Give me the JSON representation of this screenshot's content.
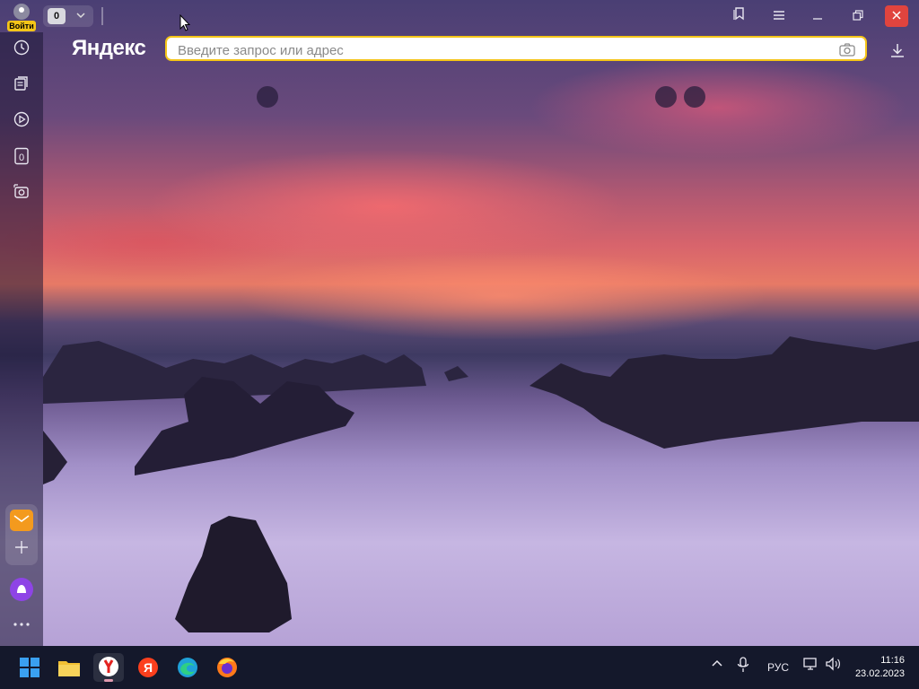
{
  "window": {
    "login_label": "Войти",
    "tab_count": "0",
    "controls": {
      "minimize": "minimize-icon",
      "restore": "restore-icon",
      "close": "close-icon"
    }
  },
  "sidebar": {
    "items": [
      "history-icon",
      "collections-icon",
      "video-icon",
      "tab-counter-icon",
      "screenshot-icon"
    ],
    "tab_counter_value": "0",
    "bottom": [
      "mail-icon",
      "add-icon",
      "alice-icon",
      "more-icon"
    ]
  },
  "header": {
    "logo": "Яндекс",
    "search_placeholder": "Введите запрос или адрес",
    "search_value": ""
  },
  "taskbar": {
    "apps": [
      "windows-start",
      "file-explorer",
      "yandex-browser",
      "yandex",
      "edge",
      "firefox"
    ],
    "language": "РУС",
    "time": "11:16",
    "date": "23.02.2023"
  },
  "colors": {
    "accent": "#f5c518",
    "close": "#e0443e",
    "taskbar": "#14182b"
  }
}
